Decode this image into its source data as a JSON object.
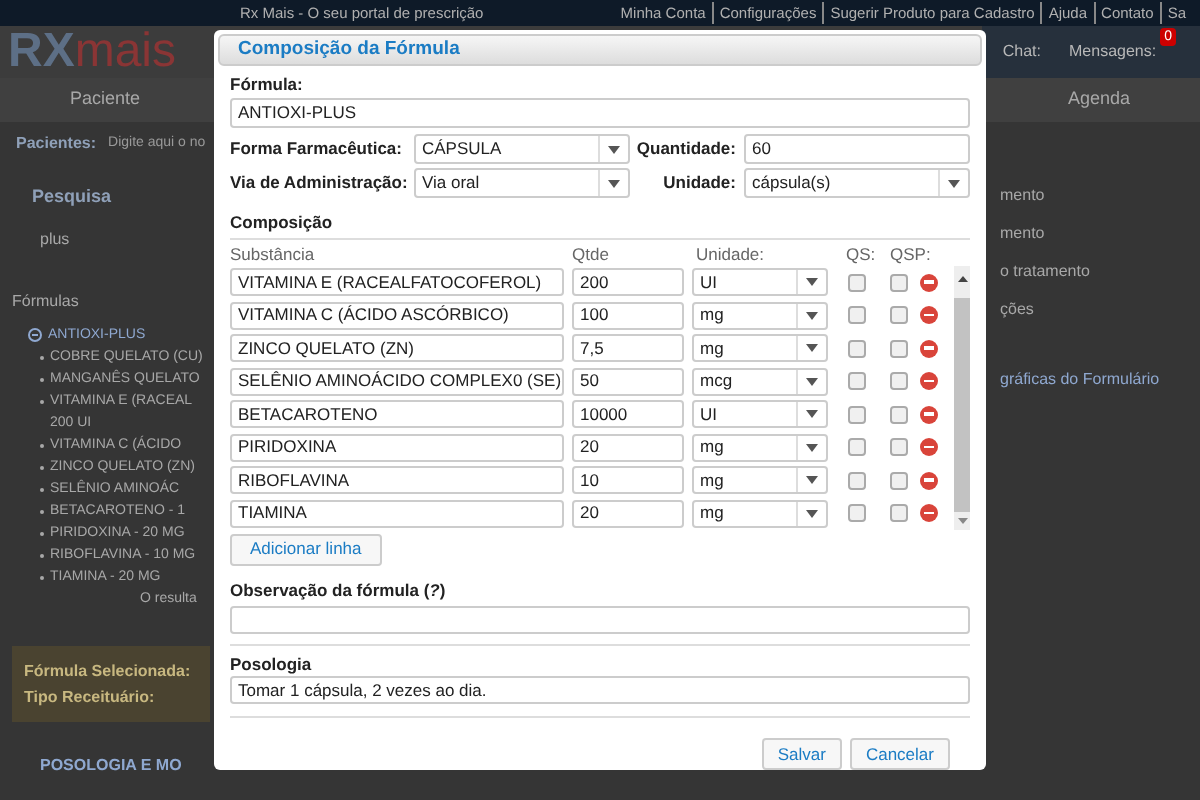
{
  "background": {
    "site_title": "Rx Mais - O seu portal de prescrição",
    "top_links": [
      "Minha Conta",
      "Configurações",
      "Sugerir Produto para Cadastro",
      "Ajuda",
      "Contato",
      "Sa"
    ],
    "logo": {
      "letters": "RX",
      "word": "mais"
    },
    "header_items": [
      {
        "label": "Chat:"
      },
      {
        "label": "Mensagens:",
        "badge": "0"
      }
    ],
    "nav": [
      "Paciente",
      "Agenda"
    ],
    "patient_label": "Pacientes:",
    "patient_placeholder": "Digite aqui o no",
    "search_title": "Pesquisa",
    "search_value": "plus",
    "formulas_title": "Fórmulas",
    "tree": {
      "label": "ANTIOXI-PLUS",
      "expanded": true,
      "children": [
        {
          "label": "COBRE QUELATO (CU)"
        },
        {
          "label": "MANGANÊS QUELATO"
        },
        {
          "label": "VITAMINA E (RACEAL",
          "continuation": "200 UI"
        },
        {
          "label": "VITAMINA C (ÁCIDO"
        },
        {
          "label": "ZINCO QUELATO (ZN)"
        },
        {
          "label": "SELÊNIO AMINOÁC"
        },
        {
          "label": "BETACAROTENO - 1"
        },
        {
          "label": "PIRIDOXINA - 20 MG"
        },
        {
          "label": "RIBOFLAVINA - 10 MG"
        },
        {
          "label": "TIAMINA - 20 MG"
        }
      ]
    },
    "result_note": "O resulta",
    "selected_box": [
      "Fórmula Selecionada:",
      "Tipo Receituário:"
    ],
    "section_heading": "POSOLOGIA E MO",
    "right_items": [
      "mento",
      "mento",
      "o tratamento",
      "ções",
      "gráficas do Formulário"
    ]
  },
  "dialog": {
    "title": "Composição da Fórmula",
    "formula": {
      "label": "Fórmula:",
      "value": "ANTIOXI-PLUS"
    },
    "forma": {
      "label": "Forma Farmacêutica:",
      "value": "CÁPSULA"
    },
    "quantidade": {
      "label": "Quantidade:",
      "value": "60"
    },
    "via": {
      "label": "Via de Administração:",
      "value": "Via oral"
    },
    "unidade": {
      "label": "Unidade:",
      "value": "cápsula(s)"
    },
    "composition_title": "Composição",
    "columns": [
      "Substância",
      "Qtde",
      "Unidade:",
      "QS:",
      "QSP:"
    ],
    "rows": [
      {
        "substance": "VITAMINA E (RACEALFATOCOFEROL)",
        "qty": "200",
        "unit": "UI",
        "qs": false,
        "qsp": false
      },
      {
        "substance": "VITAMINA C (ÁCIDO ASCÓRBICO)",
        "qty": "100",
        "unit": "mg",
        "qs": false,
        "qsp": false
      },
      {
        "substance": "ZINCO QUELATO (ZN)",
        "qty": "7,5",
        "unit": "mg",
        "qs": false,
        "qsp": false
      },
      {
        "substance": "SELÊNIO AMINOÁCIDO COMPLEX0 (SE)",
        "qty": "50",
        "unit": "mcg",
        "qs": false,
        "qsp": false
      },
      {
        "substance": "BETACAROTENO",
        "qty": "10000",
        "unit": "UI",
        "qs": false,
        "qsp": false
      },
      {
        "substance": "PIRIDOXINA",
        "qty": "20",
        "unit": "mg",
        "qs": false,
        "qsp": false
      },
      {
        "substance": "RIBOFLAVINA",
        "qty": "10",
        "unit": "mg",
        "qs": false,
        "qsp": false
      },
      {
        "substance": "TIAMINA",
        "qty": "20",
        "unit": "mg",
        "qs": false,
        "qsp": false
      }
    ],
    "add_button": "Adicionar linha",
    "observation": {
      "label": "Observação da fórmula (*?*)"
    },
    "posologia": {
      "label": "Posologia",
      "value": "Tomar 1 cápsula, 2 vezes ao dia."
    },
    "buttons": [
      "Salvar",
      "Cancelar"
    ]
  }
}
